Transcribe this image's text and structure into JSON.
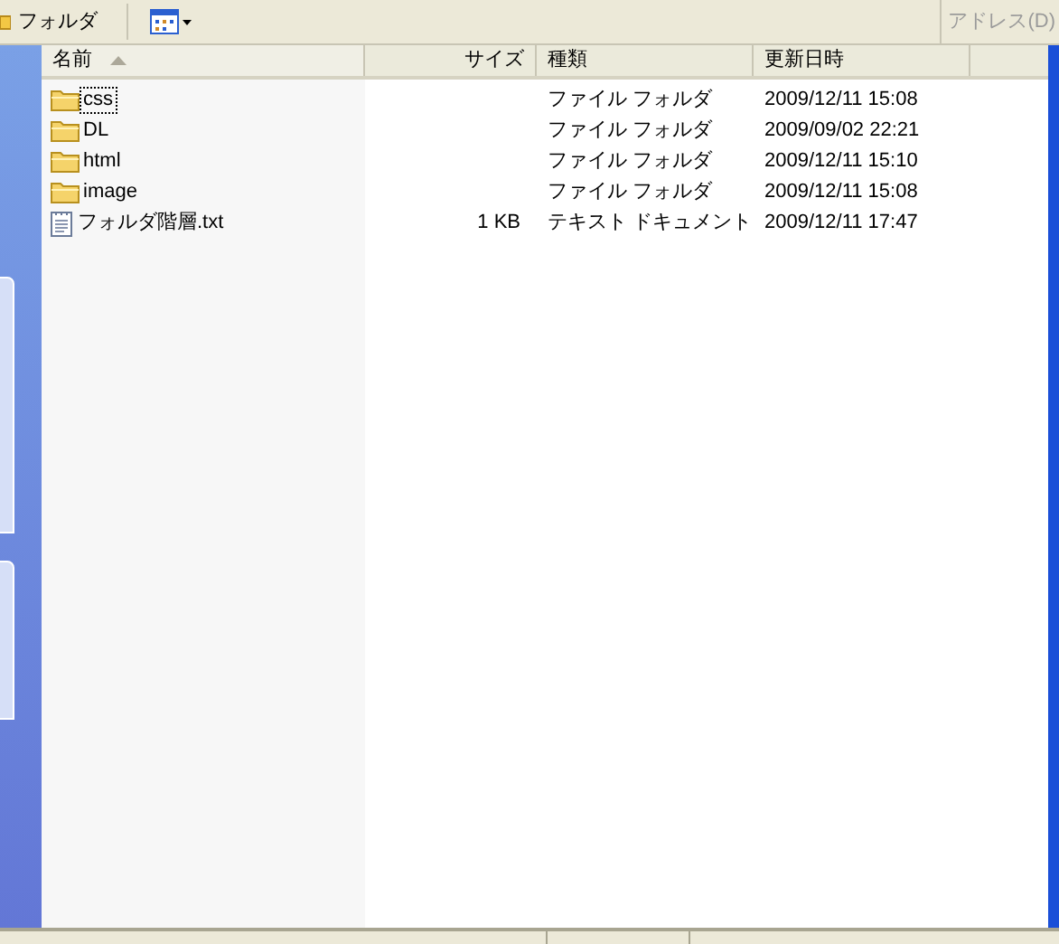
{
  "toolbar": {
    "folders_button": "フォルダ",
    "address_label": "アドレス(D)"
  },
  "columns": [
    {
      "label": "名前",
      "sorted": true
    },
    {
      "label": "サイズ",
      "sorted": false
    },
    {
      "label": "種類",
      "sorted": false
    },
    {
      "label": "更新日時",
      "sorted": false
    }
  ],
  "files": [
    {
      "kind": "folder",
      "name": "css",
      "type": "ファイル フォルダ",
      "modified": "2009/12/11 15:08",
      "focused": true
    },
    {
      "kind": "folder",
      "name": "DL",
      "type": "ファイル フォルダ",
      "modified": "2009/09/02 22:21",
      "focused": false
    },
    {
      "kind": "folder",
      "name": "html",
      "type": "ファイル フォルダ",
      "modified": "2009/12/11 15:10",
      "focused": false
    },
    {
      "kind": "folder",
      "name": "image",
      "type": "ファイル フォルダ",
      "modified": "2009/12/11 15:08",
      "focused": false
    },
    {
      "kind": "text",
      "name": "フォルダ階層.txt",
      "size": "1 KB",
      "type": "テキスト ドキュメント",
      "modified": "2009/12/11 17:47",
      "focused": false
    }
  ]
}
